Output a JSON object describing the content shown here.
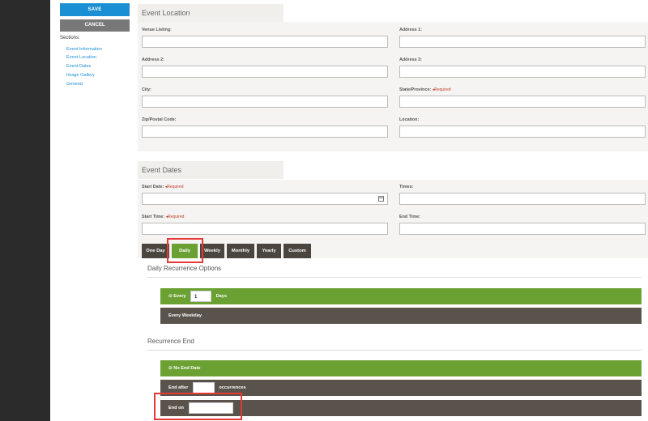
{
  "toolbar": {
    "save_label": "SAVE",
    "cancel_label": "CANCEL"
  },
  "sidebar": {
    "sections_label": "Sections:",
    "items": [
      {
        "label": "Event Information"
      },
      {
        "label": "Event Location"
      },
      {
        "label": "Event Dates"
      },
      {
        "label": "Image Gallery"
      },
      {
        "label": "General"
      }
    ]
  },
  "location": {
    "title": "Event Location",
    "venue_label": "Venue Listing:",
    "address1_label": "Address 1:",
    "address2_label": "Address 2:",
    "address3_label": "Address 3:",
    "city_label": "City:",
    "state_label": "State/Province:",
    "state_required": "◂Required",
    "zip_label": "Zip/Postal Code:",
    "location_label": "Location:"
  },
  "dates": {
    "title": "Event Dates",
    "start_date_label": "Start Date:",
    "start_date_required": "◂Required",
    "times_label": "Times:",
    "start_time_label": "Start Time:",
    "start_time_required": "◂Required",
    "end_time_label": "End Time:",
    "tabs": [
      {
        "label": "One Day"
      },
      {
        "label": "Daily"
      },
      {
        "label": "Weekly"
      },
      {
        "label": "Monthly"
      },
      {
        "label": "Yearly"
      },
      {
        "label": "Custom"
      }
    ],
    "daily_heading": "Daily Recurrence Options",
    "every_prefix": "⊙ Every",
    "every_value": "1",
    "every_suffix": "Days",
    "every_weekday": "Every Weekday",
    "recurrence_end_heading": "Recurrence End",
    "no_end_date": "⊙ No End Date",
    "end_after_prefix": "End after",
    "end_after_value": "",
    "end_after_suffix": "occurrences",
    "end_on_label": "End on",
    "end_on_value": ""
  },
  "colors": {
    "accent_blue": "#1b8fd3",
    "green": "#6aa132",
    "dark": "#59534c",
    "highlight": "#e53935"
  }
}
